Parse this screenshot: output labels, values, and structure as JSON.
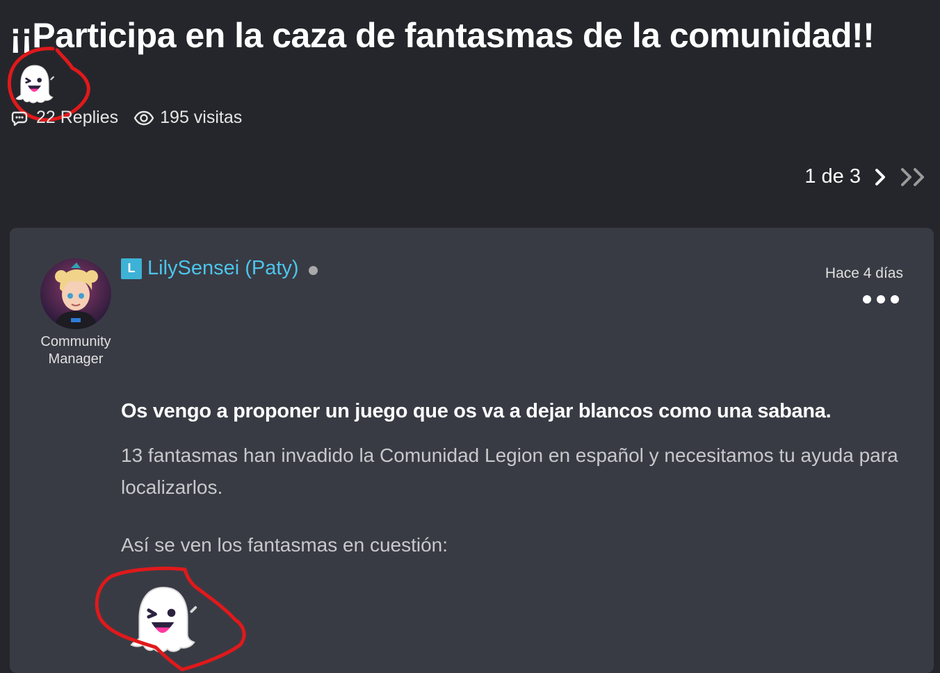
{
  "thread": {
    "title": "¡¡Participa en la caza de fantasmas de la comunidad!!",
    "replies_label": "22 Replies",
    "views_label": "195 visitas"
  },
  "pagination": {
    "text": "1 de 3"
  },
  "post": {
    "author": "LilySensei (Paty)",
    "rank_letter": "L",
    "role": "Community Manager",
    "time": "Hace 4 días",
    "lead": "Os vengo a proponer un juego que os va a dejar blancos como una sabana.",
    "paragraph1": "13 fantasmas han invadido la Comunidad Legion en español y necesitamos tu ayuda para localizarlos.",
    "paragraph2": "Así se ven los fantasmas en cuestión:"
  },
  "colors": {
    "page_bg": "#25262b",
    "card_bg": "#393b44",
    "author_link": "#4cc5ec",
    "annotation_red": "#e0191b"
  },
  "icons": [
    "ghost-icon",
    "replies-icon",
    "eye-icon",
    "chevron-right-icon",
    "double-chevron-right-icon",
    "more-options-icon",
    "online-status-dot"
  ]
}
